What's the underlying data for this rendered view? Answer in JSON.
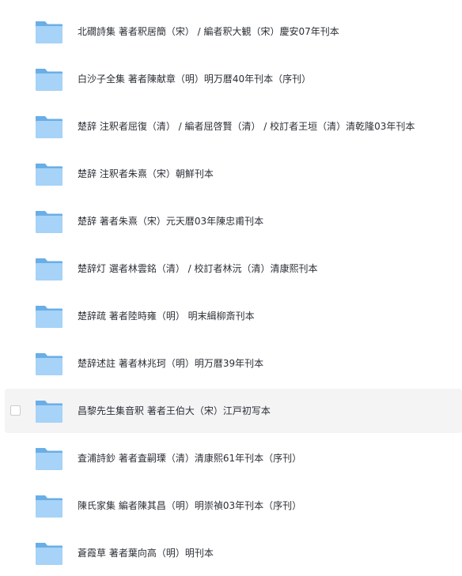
{
  "files": [
    {
      "name": "北礀詩集  著者釈居簡（宋） / 編者釈大観（宋）慶安07年刊本",
      "icon": "folder-icon"
    },
    {
      "name": "白沙子全集 著者陳献章（明）明万暦40年刊本（序刊）",
      "icon": "folder-icon"
    },
    {
      "name": "楚辞  注釈者屈復（清） / 編者屈啓賢（清） / 校訂者王垣（清）清乾隆03年刊本",
      "icon": "folder-icon"
    },
    {
      "name": "楚辞  注釈者朱熹（宋）朝鮮刊本",
      "icon": "folder-icon"
    },
    {
      "name": "楚辞  著者朱熹（宋）元天暦03年陳忠甫刊本",
      "icon": "folder-icon"
    },
    {
      "name": "楚辞灯 選者林雲銘（清） / 校訂者林沅（清）清康熙刊本",
      "icon": "folder-icon"
    },
    {
      "name": "楚辞疏 著者陸時雍（明） 明末緝柳斎刊本",
      "icon": "folder-icon"
    },
    {
      "name": "楚辞述註 著者林兆珂（明）明万暦39年刊本",
      "icon": "folder-icon"
    },
    {
      "name": "昌黎先生集音釈  著者王伯大（宋）江戸初写本",
      "icon": "folder-icon",
      "hovered": true
    },
    {
      "name": "査浦詩鈔  著者査嗣瑮（清）清康熙61年刊本（序刊）",
      "icon": "folder-icon"
    },
    {
      "name": "陳氏家集 編者陳其昌（明）明崇禎03年刊本（序刊）",
      "icon": "folder-icon"
    },
    {
      "name": "蒼霞草  著者葉向高（明）明刊本",
      "icon": "folder-icon"
    }
  ],
  "colors": {
    "folder_back": "#6aaee6",
    "folder_front": "#a6d3f7",
    "hover_bg": "#f4f4f5",
    "text": "#2b2f36"
  }
}
